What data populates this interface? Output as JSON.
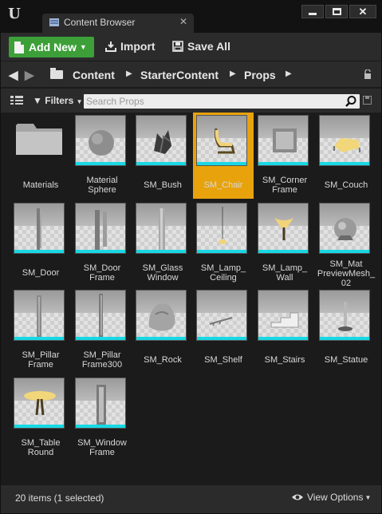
{
  "window": {
    "tab_label": "Content Browser",
    "tab_close": "✕"
  },
  "toolbar": {
    "add_new_label": "Add New",
    "import_label": "Import",
    "save_all_label": "Save All"
  },
  "path": {
    "crumbs": [
      "Content",
      "StarterContent",
      "Props"
    ],
    "separator": "▶"
  },
  "filter": {
    "filters_label": "Filters",
    "search_placeholder": "Search Props"
  },
  "assets": [
    {
      "label": "Materials",
      "kind": "folder",
      "selected": false
    },
    {
      "label": "Material\nSphere",
      "kind": "sphere",
      "selected": false
    },
    {
      "label": "SM_Bush",
      "kind": "bush",
      "selected": false
    },
    {
      "label": "SM_Chair",
      "kind": "chair",
      "selected": true
    },
    {
      "label": "SM_Corner\nFrame",
      "kind": "corner",
      "selected": false
    },
    {
      "label": "SM_Couch",
      "kind": "couch",
      "selected": false
    },
    {
      "label": "SM_Door",
      "kind": "door",
      "selected": false
    },
    {
      "label": "SM_Door\nFrame",
      "kind": "doorframe",
      "selected": false
    },
    {
      "label": "SM_Glass\nWindow",
      "kind": "glass",
      "selected": false
    },
    {
      "label": "SM_Lamp_\nCeiling",
      "kind": "lampceiling",
      "selected": false
    },
    {
      "label": "SM_Lamp_\nWall",
      "kind": "lampwall",
      "selected": false
    },
    {
      "label": "SM_Mat\nPreviewMesh_\n02",
      "kind": "matpreview",
      "selected": false
    },
    {
      "label": "SM_Pillar\nFrame",
      "kind": "pillar",
      "selected": false
    },
    {
      "label": "SM_Pillar\nFrame300",
      "kind": "pillar300",
      "selected": false
    },
    {
      "label": "SM_Rock",
      "kind": "rock",
      "selected": false
    },
    {
      "label": "SM_Shelf",
      "kind": "shelf",
      "selected": false
    },
    {
      "label": "SM_Stairs",
      "kind": "stairs",
      "selected": false
    },
    {
      "label": "SM_Statue",
      "kind": "statue",
      "selected": false
    },
    {
      "label": "SM_Table\nRound",
      "kind": "table",
      "selected": false
    },
    {
      "label": "SM_Window\nFrame",
      "kind": "windowframe",
      "selected": false
    }
  ],
  "footer": {
    "status": "20 items (1 selected)",
    "view_options_label": "View Options"
  },
  "colors": {
    "selection": "#e8a20c",
    "add_new": "#3c9f38",
    "thumb_accent": "#18d8e4"
  }
}
